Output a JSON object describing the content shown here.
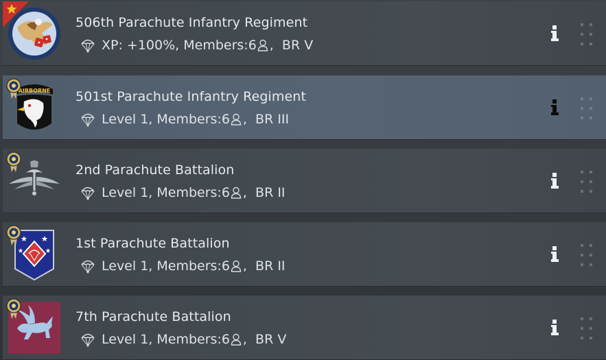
{
  "regiments": [
    {
      "title": "506th Parachute Infantry Regiment",
      "stat": "XP: +100%",
      "members_label": "Members:",
      "members": "6",
      "br": "BR V",
      "emblem": "eagle-dice-emblem",
      "marker": "red-star-flag",
      "selected": false
    },
    {
      "title": "501st Parachute Infantry Regiment",
      "stat": "Level 1",
      "members_label": "Members:",
      "members": "6",
      "br": "BR III",
      "emblem": "airborne-eagle-emblem",
      "marker": "medal-badge",
      "selected": true
    },
    {
      "title": "2nd Parachute Battalion",
      "stat": "Level 1",
      "members_label": "Members:",
      "members": "6",
      "br": "BR II",
      "emblem": "winged-parachute-emblem",
      "marker": "medal-badge",
      "selected": false
    },
    {
      "title": "1st Parachute Battalion",
      "stat": "Level 1",
      "members_label": "Members:",
      "members": "6",
      "br": "BR II",
      "emblem": "blue-diamond-stars-emblem",
      "marker": "medal-badge",
      "selected": false
    },
    {
      "title": "7th Parachute Battalion",
      "stat": "Level 1",
      "members_label": "Members:",
      "members": "6",
      "br": "BR V",
      "emblem": "pegasus-emblem",
      "marker": "medal-badge",
      "selected": false
    }
  ],
  "colors": {
    "row_bg": "#41474d",
    "row_selected_bg": "#536171",
    "text": "#e6eaee",
    "flag_red": "#c8312a",
    "star_yellow": "#f2c12e",
    "medal_gold": "#d8b75c"
  }
}
